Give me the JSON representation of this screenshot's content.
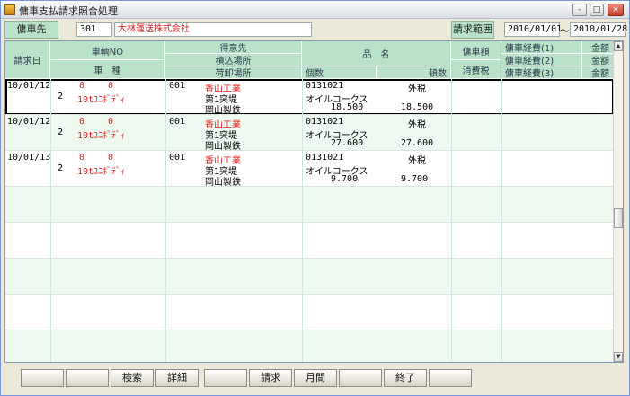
{
  "window": {
    "title": "傭車支払請求照合処理"
  },
  "titlebar": {
    "min": "-",
    "max": "□",
    "close": "×"
  },
  "top": {
    "vendor_label": "傭車先",
    "vendor_code": "301",
    "vendor_name": "大林運送株式会社",
    "range_label": "請求範囲",
    "date_from": "2010/01/01",
    "tilde": "～",
    "date_to": "2010/01/28"
  },
  "header": {
    "billing_date": "請求日",
    "vehicle_no": "車輌NO",
    "vehicle_type": "車　種",
    "customer": "得意先",
    "loading_place": "積込場所",
    "unloading_place": "荷卸場所",
    "item_name": "品　名",
    "quantity": "個数",
    "weight": "頓数",
    "charter_fee": "傭車額",
    "consumption_tax": "消費税",
    "expense1": "傭車経費(1)",
    "expense2": "傭車経費(2)",
    "expense3": "傭車経費(3)",
    "amount1": "金額",
    "amount2": "金額",
    "amount3": "金額"
  },
  "rows": [
    {
      "date": "10/01/12",
      "num_a": "0",
      "num_b": "0",
      "seq": "2",
      "vtype": "10tﾕﾆﾎﾞﾃﾞｨ",
      "cust_code": "001",
      "customer": "香山工業",
      "load": "第1突堤",
      "unload": "岡山製鉄",
      "item_code": "0131021",
      "tax_type": "外税",
      "item_name": "オイルコークス",
      "qty": "18.500",
      "weight": "18.500"
    },
    {
      "date": "10/01/12",
      "num_a": "0",
      "num_b": "0",
      "seq": "2",
      "vtype": "10tﾕﾆﾎﾞﾃﾞｨ",
      "cust_code": "001",
      "customer": "香山工業",
      "load": "第1突堤",
      "unload": "岡山製鉄",
      "item_code": "0131021",
      "tax_type": "外税",
      "item_name": "オイルコークス",
      "qty": "27.600",
      "weight": "27.600"
    },
    {
      "date": "10/01/13",
      "num_a": "0",
      "num_b": "0",
      "seq": "2",
      "vtype": "10tﾕﾆﾎﾞﾃﾞｨ",
      "cust_code": "001",
      "customer": "香山工業",
      "load": "第1突堤",
      "unload": "岡山製鉄",
      "item_code": "0131021",
      "tax_type": "外税",
      "item_name": "オイルコークス",
      "qty": "9.700",
      "weight": "9.700"
    }
  ],
  "footer": {
    "b1": "",
    "b2": "",
    "search": "検索",
    "detail": "詳細",
    "b5": "",
    "billing": "請求",
    "monthly": "月間",
    "b8": "",
    "exit": "終了",
    "b10": ""
  }
}
